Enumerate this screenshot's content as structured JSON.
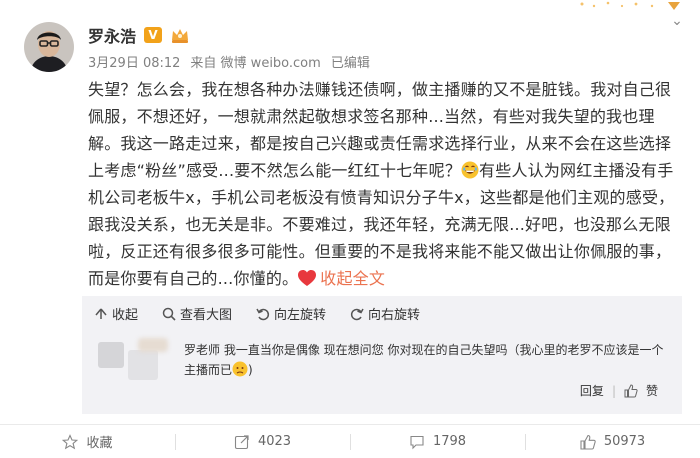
{
  "post": {
    "author": "罗永浩",
    "verified_badge": "V",
    "time": "3月29日 08:12",
    "source": "来自 微博 weibo.com",
    "edited": "已编辑",
    "text_main": "失望？怎么会，我在想各种办法赚钱还债啊，做主播赚的又不是脏钱。我对自己很佩服，不想还好，一想就肃然起敬想求签名那种...当然，有些对我失望的我也理解。我这一路走过来，都是按自己兴趣或责任需求选择行业，从来不会在这些选择上考虑“粉丝”感受...要不然怎么能一红红十七年呢？",
    "text_after_emoji": "有些人认为网红主播没有手机公司老板牛x，手机公司老板没有愤青知识分子牛x，这些都是他们主观的感受，跟我没关系，也无关是非。不要难过，我还年轻，充满无限...好吧，也没那么无限啦，反正还有很多很多可能性。但重要的不是我将来能不能又做出让你佩服的事，而是你要有自己的...你懂的。",
    "collapse_text": "收起全文",
    "icons": [
      "crown-icon",
      "grin-emoji-icon",
      "heart-icon"
    ]
  },
  "toolbar": {
    "collapse": "收起",
    "view_large": "查看大图",
    "rotate_left": "向左旋转",
    "rotate_right": "向右旋转"
  },
  "comment": {
    "text": "罗老师 我一直当你是偶像 现在想问您 你对现在的自己失望吗（我心里的老罗不应该是一个主播而已",
    "reply": "回复",
    "like": "赞"
  },
  "footer": {
    "favorite": "收藏",
    "reposts": "4023",
    "comments": "1798",
    "likes": "50973"
  },
  "colors": {
    "accent": "#eb7350",
    "badge": "#f2a21a",
    "panel": "#f2f2f5"
  }
}
